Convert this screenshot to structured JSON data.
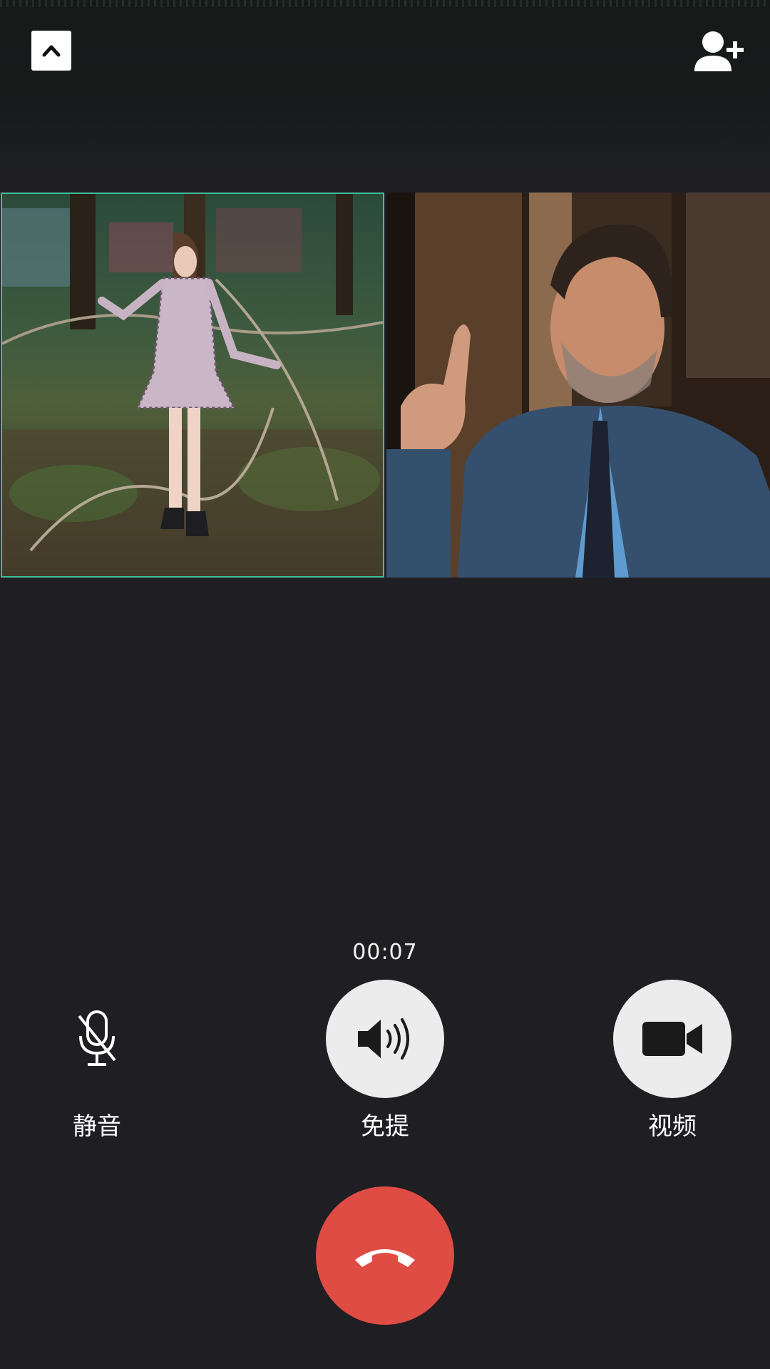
{
  "call": {
    "timer": "00:07"
  },
  "controls": {
    "mute_label": "静音",
    "speaker_label": "免提",
    "video_label": "视频"
  },
  "icons": {
    "collapse": "chevron-up-icon",
    "add_member": "add-user-icon",
    "mute": "mic-off-icon",
    "speaker": "speaker-icon",
    "video": "video-camera-icon",
    "hangup": "phone-hangup-icon"
  },
  "colors": {
    "background": "#1f1f23",
    "hangup": "#df4c44",
    "control_circle": "#ececec",
    "active_tile_border": "#3ec09a"
  }
}
